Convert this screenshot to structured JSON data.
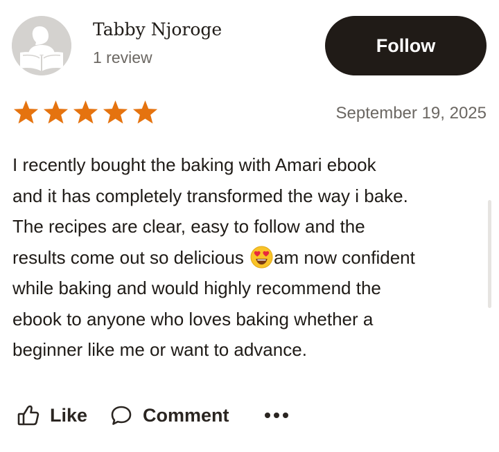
{
  "reviewer": {
    "name": "Tabby Njoroge",
    "review_count": "1 review",
    "avatar_icon": "reader-silhouette-icon"
  },
  "follow_button": {
    "label": "Follow",
    "background": "#201b17",
    "text_color": "#ffffff"
  },
  "rating": {
    "value": 5,
    "max": 5,
    "star_color": "#e5730f"
  },
  "review": {
    "date": "September 19, 2025",
    "lines": [
      "I recently bought the baking with Amari ebook",
      "and it has completely transformed the way i bake.",
      "The recipes are clear, easy to follow and the",
      "results come out so delicious ",
      "am now confident",
      "while baking and would highly recommend the",
      "ebook to anyone who loves baking whether a",
      "beginner like me or want to advance."
    ],
    "emoji": "heart-eyes-emoji"
  },
  "actions": {
    "like_label": "Like",
    "like_icon": "thumbs-up-icon",
    "comment_label": "Comment",
    "comment_icon": "speech-bubble-icon",
    "more_icon": "more-dots-icon"
  }
}
